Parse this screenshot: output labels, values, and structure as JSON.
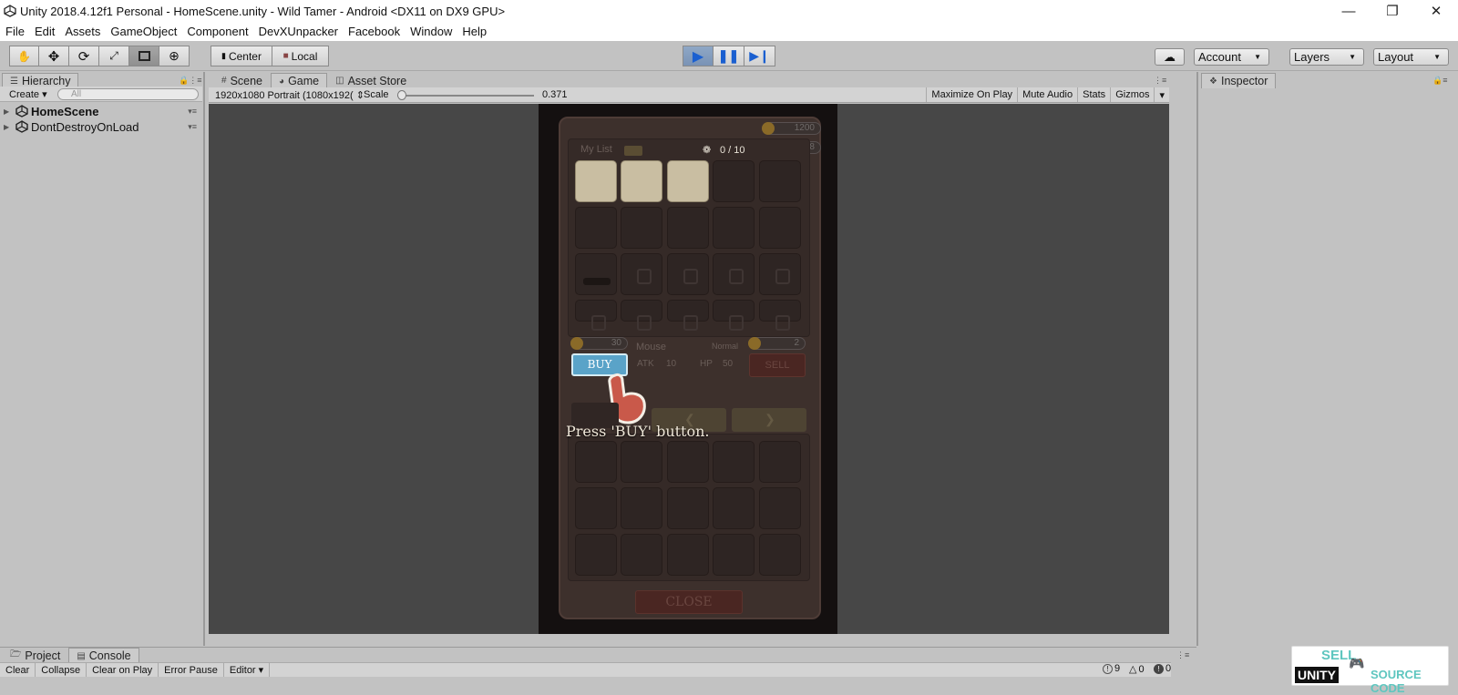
{
  "title_bar": {
    "title": "Unity 2018.4.12f1 Personal - HomeScene.unity - Wild Tamer - Android <DX11 on DX9 GPU>"
  },
  "menu": [
    "File",
    "Edit",
    "Assets",
    "GameObject",
    "Component",
    "DevXUnpacker",
    "Facebook",
    "Window",
    "Help"
  ],
  "toolbar": {
    "tools": [
      "hand-tool",
      "move-tool",
      "rotate-tool",
      "scale-tool",
      "rect-tool",
      "transform-tool"
    ],
    "active_tool": "rect-tool",
    "pivot": "Center",
    "space": "Local",
    "account": "Account",
    "layers": "Layers",
    "layout": "Layout"
  },
  "hierarchy": {
    "tab": "Hierarchy",
    "create": "Create",
    "search_placeholder": "All",
    "items": [
      "HomeScene",
      "DontDestroyOnLoad"
    ]
  },
  "center_tabs": [
    "Scene",
    "Game",
    "Asset Store"
  ],
  "active_center_tab": "Game",
  "game_bar": {
    "resolution": "1920x1080 Portrait (1080x192(",
    "scale_label": "Scale",
    "scale_value": "0.371",
    "toggles": [
      "Maximize On Play",
      "Mute Audio",
      "Stats",
      "Gizmos"
    ]
  },
  "inspector": {
    "tab": "Inspector"
  },
  "game": {
    "gold": "1200",
    "gems": "128",
    "list_title": "My List",
    "capacity": "0 / 10",
    "buy_price": "30",
    "sell_price": "2",
    "monster_name": "Mouse",
    "monster_rarity": "Normal",
    "atk_label": "ATK",
    "atk_value": "10",
    "hp_label": "HP",
    "hp_value": "50",
    "buy_label": "BUY",
    "sell_label": "SELL",
    "close_label": "CLOSE",
    "tutorial_text": "Press 'BUY' button.",
    "colors": {
      "buy_button": "#5aa3c8",
      "pointer_hand": "#c9594a",
      "slot_filled": "#c9bea2"
    }
  },
  "bottom_tabs": [
    "Project",
    "Console"
  ],
  "active_bottom_tab": "Console",
  "console": {
    "buttons": [
      "Clear",
      "Collapse",
      "Clear on Play",
      "Error Pause",
      "Editor"
    ],
    "log_count": "9",
    "warn_count": "0",
    "error_count": "0"
  },
  "watermark": {
    "line1": "SELL",
    "line2": "UNITY",
    "line3": "SOURCE CODE"
  }
}
